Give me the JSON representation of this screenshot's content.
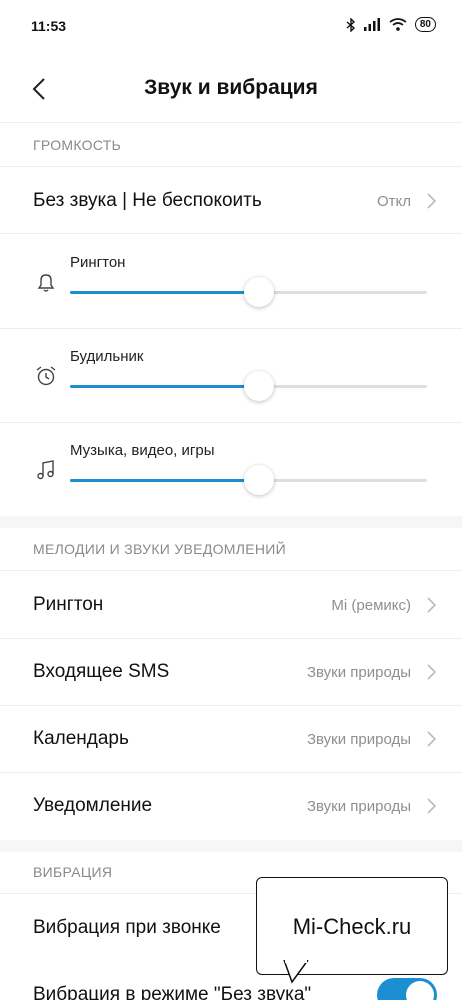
{
  "status_bar": {
    "time": "11:53",
    "battery": "80",
    "icons": [
      "bluetooth-icon",
      "signal-icon",
      "wifi-icon",
      "battery-icon"
    ]
  },
  "header": {
    "back_icon": "chevron-left-icon",
    "title": "Звук и вибрация"
  },
  "volume_section": {
    "title": "ГРОМКОСТЬ",
    "dnd_row": {
      "label": "Без звука | Не беспокоить",
      "value": "Откл"
    },
    "sliders": [
      {
        "label": "Рингтон",
        "icon": "bell-icon",
        "level": 0.53
      },
      {
        "label": "Будильник",
        "icon": "alarm-clock-icon",
        "level": 0.53
      },
      {
        "label": "Музыка, видео, игры",
        "icon": "music-note-icon",
        "level": 0.53
      }
    ]
  },
  "sounds_section": {
    "title": "МЕЛОДИИ И ЗВУКИ УВЕДОМЛЕНИЙ",
    "rows": [
      {
        "label": "Рингтон",
        "value": "Mi (ремикс)"
      },
      {
        "label": "Входящее SMS",
        "value": "Звуки природы"
      },
      {
        "label": "Календарь",
        "value": "Звуки природы"
      },
      {
        "label": "Уведомление",
        "value": "Звуки природы"
      }
    ]
  },
  "vibration_section": {
    "title": "ВИБРАЦИЯ",
    "rows": [
      {
        "label": "Вибрация при звонке"
      },
      {
        "label": "Вибрация в режиме \"Без звука\"",
        "toggle_on": true
      }
    ]
  },
  "watermark": {
    "text": "Mi-Check.ru"
  },
  "colors": {
    "accent": "#1b8fd1",
    "section_text": "#8a8a8a",
    "value_text": "#8f8f8f"
  }
}
